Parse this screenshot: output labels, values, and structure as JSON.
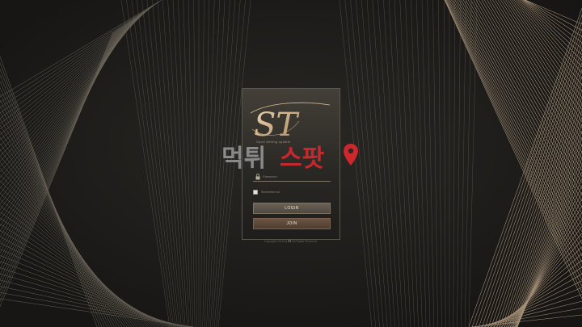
{
  "brand": {
    "logo_text": "ST",
    "tagline": "Sport betting system"
  },
  "form": {
    "password_placeholder": "Password",
    "remember_label": "Remember me",
    "login_label": "LOGIN",
    "join_label": "JOIN"
  },
  "footer": {
    "copyright_prefix": "Copyright 2018 by",
    "copyright_brand": "ST",
    "copyright_suffix": "All Rights Reserved."
  },
  "watermark": {
    "text_gray": "먹튀",
    "text_red": "스팟"
  },
  "colors": {
    "background": "#1c1b19",
    "gold": "#c7a580",
    "watermark_gray": "#9a9a9a",
    "watermark_red": "#e0282e"
  }
}
